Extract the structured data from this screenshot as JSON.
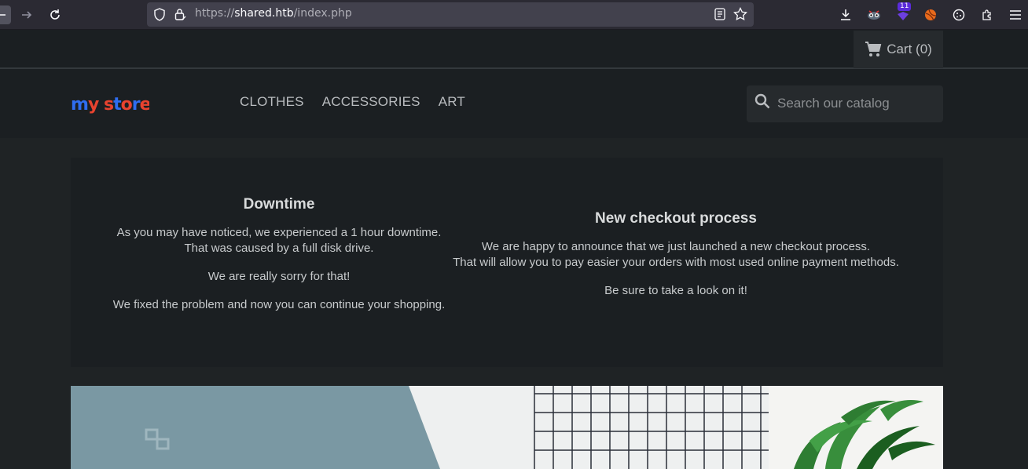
{
  "browser": {
    "url_prefix": "https://",
    "url_host": "shared.htb",
    "url_path": "/index.php",
    "extension_badge": "11"
  },
  "site": {
    "cart_label": "Cart (0)",
    "logo_text": "my store",
    "menu": [
      "CLOTHES",
      "ACCESSORIES",
      "ART"
    ],
    "search_placeholder": "Search our catalog"
  },
  "announcements": [
    {
      "title": "Downtime",
      "paragraphs": [
        "As you may have noticed, we experienced a 1 hour downtime.",
        "That was caused by a full disk drive.",
        "We are really sorry for that!",
        "We fixed the problem and now you can continue your shopping."
      ]
    },
    {
      "title": "New checkout process",
      "paragraphs": [
        "We are happy to announce that we just launched a new checkout process.",
        "That will allow you to pay easier your orders with most used online payment methods.",
        "Be sure to take a look on it!"
      ]
    }
  ],
  "colors": {
    "accent_logo_blue": "#2f6df0",
    "accent_logo_red": "#e8432f"
  }
}
